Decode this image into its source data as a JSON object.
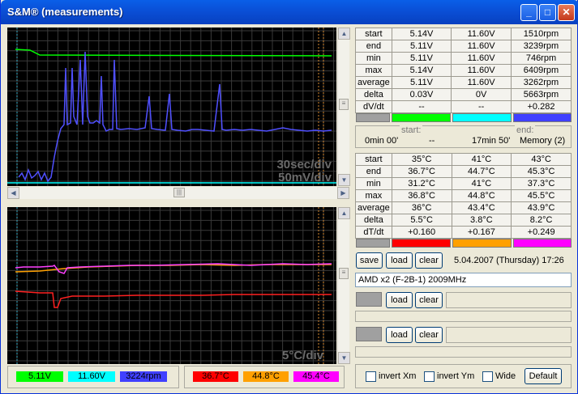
{
  "window": {
    "title": "S&M® (measurements)",
    "min": "_",
    "max": "□",
    "close": "✕"
  },
  "chart_top": {
    "scale_time": "30sec/div",
    "scale_v": "50mV/div",
    "legend": [
      {
        "text": "5.11V",
        "bg": "#00ff00"
      },
      {
        "text": "11.60V",
        "bg": "#00ffff"
      },
      {
        "text": "3224rpm",
        "bg": "#4040ff"
      }
    ]
  },
  "chart_bottom": {
    "scale": "5°C/div",
    "legend": [
      {
        "text": "36.7°C",
        "bg": "#ff0000"
      },
      {
        "text": "44.8°C",
        "bg": "#ffa000"
      },
      {
        "text": "45.4°C",
        "bg": "#ff00ff"
      }
    ]
  },
  "volt_table": {
    "rows": [
      [
        "start",
        "5.14V",
        "11.60V",
        "1510rpm"
      ],
      [
        "end",
        "5.11V",
        "11.60V",
        "3239rpm"
      ],
      [
        "min",
        "5.11V",
        "11.60V",
        "746rpm"
      ],
      [
        "max",
        "5.14V",
        "11.60V",
        "6409rpm"
      ],
      [
        "average",
        "5.11V",
        "11.60V",
        "3262rpm"
      ],
      [
        "delta",
        "0.03V",
        "0V",
        "5663rpm"
      ],
      [
        "dV/dt",
        "--",
        "--",
        "+0.282"
      ]
    ],
    "swatches": [
      "#a0a0a0",
      "#00ff00",
      "#00ffff",
      "#4040ff"
    ]
  },
  "time_info": {
    "start_label": "start:",
    "end_label": "end:",
    "start_value": "0min 00'",
    "start_extra": "--",
    "end_value": "17min 50'",
    "end_extra": "Memory (2)"
  },
  "temp_table": {
    "rows": [
      [
        "start",
        "35°C",
        "41°C",
        "43°C"
      ],
      [
        "end",
        "36.7°C",
        "44.7°C",
        "45.3°C"
      ],
      [
        "min",
        "31.2°C",
        "41°C",
        "37.3°C"
      ],
      [
        "max",
        "36.8°C",
        "44.8°C",
        "45.5°C"
      ],
      [
        "average",
        "36°C",
        "43.4°C",
        "43.9°C"
      ],
      [
        "delta",
        "5.5°C",
        "3.8°C",
        "8.2°C"
      ],
      [
        "dT/dt",
        "+0.160",
        "+0.167",
        "+0.249"
      ]
    ],
    "swatches": [
      "#a0a0a0",
      "#ff0000",
      "#ffa000",
      "#ff00ff"
    ]
  },
  "controls": {
    "save": "save",
    "load": "load",
    "clear": "clear",
    "date": "5.04.2007 (Thursday)  17:26",
    "cpu_field": "AMD x2 (F-2B-1) 2009MHz",
    "invert_xm": "invert Xm",
    "invert_ym": "invert Ym",
    "wide": "Wide",
    "default": "Default"
  }
}
